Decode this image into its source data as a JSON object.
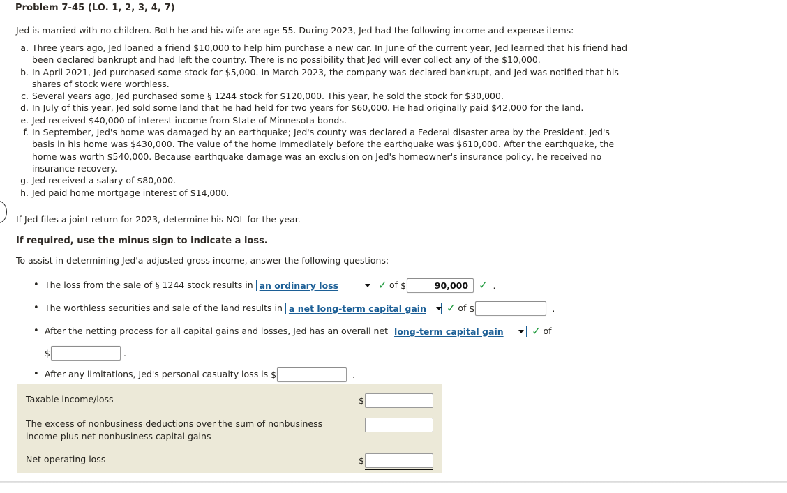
{
  "problem": {
    "title": "Problem 7-45 (LO. 1, 2, 3, 4, 7)",
    "intro": "Jed is married with no children. Both he and his wife are age 55. During 2023, Jed had the following income and expense items:",
    "items": [
      {
        "letter": "a.",
        "text": "Three years ago, Jed loaned a friend $10,000 to help him purchase a new car. In June of the current year, Jed learned that his friend had been declared bankrupt and had left the country. There is no possibility that Jed will ever collect any of the $10,000."
      },
      {
        "letter": "b.",
        "text": "In April 2021, Jed purchased some stock for $5,000. In March 2023, the company was declared bankrupt, and Jed was notified that his shares of stock were worthless."
      },
      {
        "letter": "c.",
        "text": "Several years ago, Jed purchased some § 1244 stock for $120,000. This year, he sold the stock for $30,000."
      },
      {
        "letter": "d.",
        "text": "In July of this year, Jed sold some land that he had held for two years for $60,000. He had originally paid $42,000 for the land."
      },
      {
        "letter": "e.",
        "text": "Jed received $40,000 of interest income from State of Minnesota bonds."
      },
      {
        "letter": "f.",
        "text": "In September, Jed's home was damaged by an earthquake; Jed's county was declared a Federal disaster area by the President. Jed's basis in his home was $430,000. The value of the home immediately before the earthquake was $610,000. After the earthquake, the home was worth $540,000. Because earthquake damage was an exclusion on Jed's homeowner's insurance policy, he received no insurance recovery."
      },
      {
        "letter": "g.",
        "text": "Jed received a salary of $80,000."
      },
      {
        "letter": "h.",
        "text": "Jed paid home mortgage interest of $14,000."
      }
    ],
    "joint_return": "If Jed files a joint return for 2023, determine his NOL for the year.",
    "required_note": "If required, use the minus sign to indicate a loss.",
    "assist_note": "To assist in determining Jed'a adjusted gross income, answer the following questions:"
  },
  "questions": [
    {
      "bullet": "•",
      "lead_text": "The loss from the sale of § 1244 stock results in",
      "dropdown_value": "an ordinary loss",
      "check1": "✓",
      "mid_text": "of",
      "dollar": "$",
      "input_value": "90,000",
      "input_placeholder": "",
      "check2": "✓",
      "trailing": "."
    },
    {
      "bullet": "•",
      "lead_text": "The worthless securities and sale of the land results in",
      "dropdown_value": "a net long-term capital gain",
      "check1": "✓",
      "mid_text": "of",
      "dollar": "$",
      "input_value": "",
      "input_placeholder": "",
      "trailing": "."
    },
    {
      "bullet": "•",
      "lead_text": "After the netting process for all capital gains and losses, Jed has an overall net",
      "dropdown_value": "long-term capital gain",
      "check1": "✓",
      "mid_text": "of",
      "dollar": "$",
      "input_value": "",
      "input_placeholder": "",
      "trailing": "."
    },
    {
      "bullet": "•",
      "lead_text": "After any limitations, Jed's personal casualty loss is",
      "dollar": "$",
      "input_value": "",
      "input_placeholder": "",
      "trailing": "."
    }
  ],
  "summary_table": {
    "background_color": "#ece9d8",
    "border_color": "#111111",
    "rows": [
      {
        "label": "Taxable income/loss",
        "dollar": "$",
        "value": "",
        "is_total": false
      },
      {
        "label": "The excess of nonbusiness deductions over the sum of nonbusiness income plus net nonbusiness capital gains",
        "dollar": "",
        "value": "",
        "is_total": false
      },
      {
        "label": "Net operating loss",
        "dollar": "$",
        "value": "",
        "is_total": true
      }
    ]
  },
  "colors": {
    "dropdown_text": "#1c5f96",
    "dropdown_border": "#1c5f96",
    "check_green": "#1f9a3d",
    "panel_beige": "#ece9d8",
    "body_text": "#26241f"
  }
}
